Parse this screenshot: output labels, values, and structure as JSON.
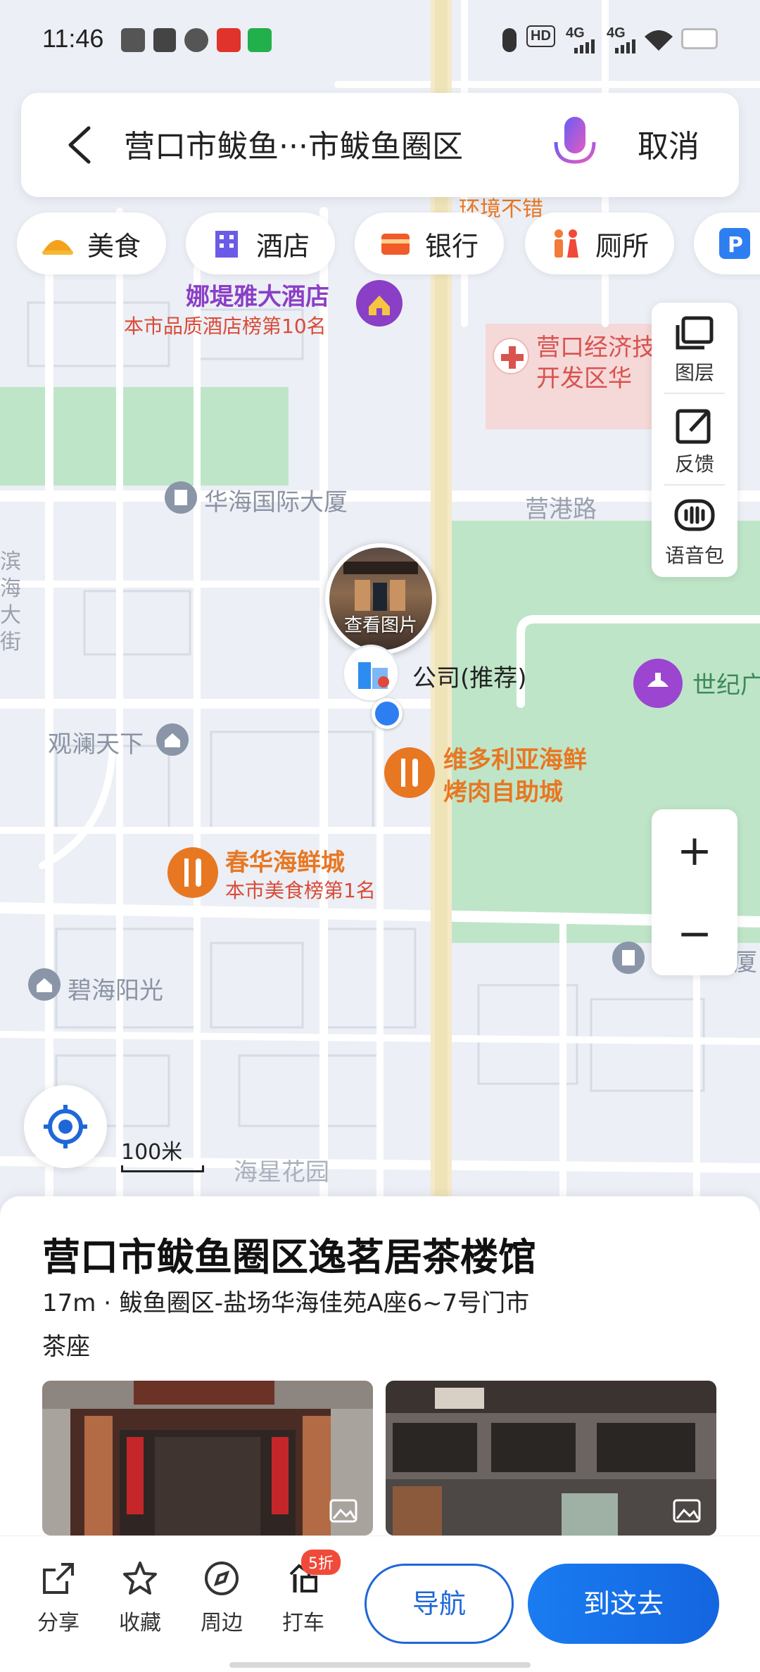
{
  "status_bar": {
    "time": "11:46",
    "hd_label": "HD",
    "net1": "4G",
    "net2": "4G"
  },
  "search": {
    "query": "营口市鲅鱼···市鲅鱼圈区",
    "cancel_label": "取消"
  },
  "categories": [
    {
      "label": "美食",
      "icon": "food-icon"
    },
    {
      "label": "酒店",
      "icon": "hotel-icon"
    },
    {
      "label": "银行",
      "icon": "bank-icon"
    },
    {
      "label": "厕所",
      "icon": "toilet-icon"
    },
    {
      "label": "",
      "icon": "parking-icon"
    }
  ],
  "toolbar": {
    "layers_label": "图层",
    "feedback_label": "反馈",
    "voice_label": "语音包"
  },
  "map": {
    "top_clipped": "环境不错",
    "hotel_name": "娜堤雅大酒店",
    "hotel_rank": "本市品质酒店榜第10名",
    "hospital_line1": "营口经济技",
    "hospital_line2": "开发区华",
    "building1": "华海国际大厦",
    "road1": "营港路",
    "left_road": "滨海大街",
    "photo_label": "查看图片",
    "company": "公司(推荐)",
    "park": "世纪广",
    "residence1": "观澜天下",
    "restaurant1_line1": "维多利亚海鲜",
    "restaurant1_line2": "烤肉自助城",
    "restaurant2_name": "春华海鲜城",
    "restaurant2_rank": "本市美食榜第1名",
    "residence2": "碧海阳光",
    "right_clipped": "厦",
    "residence3": "海星花园",
    "scale": "100米"
  },
  "place": {
    "name": "营口市鲅鱼圈区逸茗居茶楼馆",
    "distance_address": "17m · 鲅鱼圈区-盐场华海佳苑A座6~7号门市",
    "category": "茶座"
  },
  "actions": {
    "share": "分享",
    "favorite": "收藏",
    "nearby": "周边",
    "taxi": "打车",
    "taxi_badge": "5折",
    "navigate": "导航",
    "go_here": "到这去"
  },
  "colors": {
    "accent_blue": "#1f67d8",
    "poi_orange": "#e87722",
    "hotel_purple": "#8a3fc6",
    "hospital_red": "#d9534f",
    "park_green": "#b9e3c6"
  }
}
